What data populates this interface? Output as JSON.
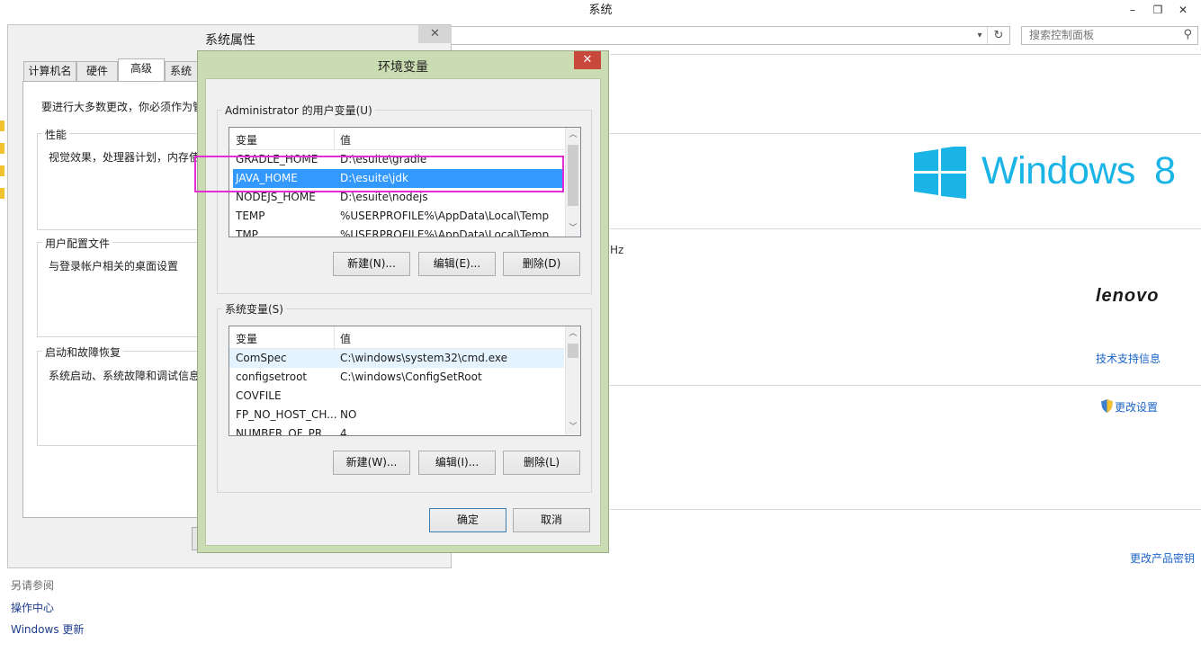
{
  "system_window": {
    "title": "系统",
    "caption_min": "–",
    "caption_max": "❐",
    "caption_close": "✕",
    "search_placeholder": "搜索控制面板",
    "windows_logo_text": "Windows",
    "windows_version": "8",
    "processor_fragment": "Hz",
    "manufacturer_logo": "lenovo",
    "support_link": "技术支持信息",
    "change_settings_link": "更改设置",
    "change_key_link": "更改产品密钥",
    "see_also_label": "另请参阅",
    "see_also_items": [
      "操作中心",
      "Windows 更新"
    ]
  },
  "sys_props": {
    "title": "系统属性",
    "tabs": [
      "计算机名",
      "硬件",
      "高级",
      "系统保"
    ],
    "intro": "要进行大多数更改，你必须作为管",
    "groups": [
      {
        "label": "性能",
        "desc": "视觉效果，处理器计划，内存使"
      },
      {
        "label": "用户配置文件",
        "desc": "与登录帐户相关的桌面设置"
      },
      {
        "label": "启动和故障恢复",
        "desc": "系统启动、系统故障和调试信息"
      }
    ]
  },
  "env_vars": {
    "title": "环境变量",
    "user_group_label": "Administrator 的用户变量(U)",
    "system_group_label": "系统变量(S)",
    "col_var": "变量",
    "col_val": "值",
    "user_rows": [
      {
        "name": "GRADLE_HOME",
        "value": "D:\\esuite\\gradle"
      },
      {
        "name": "JAVA_HOME",
        "value": "D:\\esuite\\jdk"
      },
      {
        "name": "NODEJS_HOME",
        "value": "D:\\esuite\\nodejs"
      },
      {
        "name": "TEMP",
        "value": "%USERPROFILE%\\AppData\\Local\\Temp"
      },
      {
        "name": "TMP",
        "value": "%USERPROFILE%\\AppData\\Local\\Temp"
      }
    ],
    "system_rows": [
      {
        "name": "ComSpec",
        "value": "C:\\windows\\system32\\cmd.exe"
      },
      {
        "name": "configsetroot",
        "value": "C:\\windows\\ConfigSetRoot"
      },
      {
        "name": "COVFILE",
        "value": ""
      },
      {
        "name": "FP_NO_HOST_CH...",
        "value": "NO"
      },
      {
        "name": "NUMBER_OF_PR...",
        "value": "4"
      }
    ],
    "user_buttons": {
      "new": "新建(N)...",
      "edit": "编辑(E)...",
      "delete": "删除(D)"
    },
    "system_buttons": {
      "new": "新建(W)...",
      "edit": "编辑(I)...",
      "delete": "删除(L)"
    },
    "ok": "确定",
    "cancel": "取消",
    "selected_user_row": "JAVA_HOME"
  },
  "colors": {
    "selection": "#3399ff",
    "highlight_box": "#e22bd9",
    "dialog_frame": "#cadcb1",
    "close_red": "#c9483c",
    "windows_blue": "#1ab5e6",
    "link_blue": "#1c64c8"
  }
}
